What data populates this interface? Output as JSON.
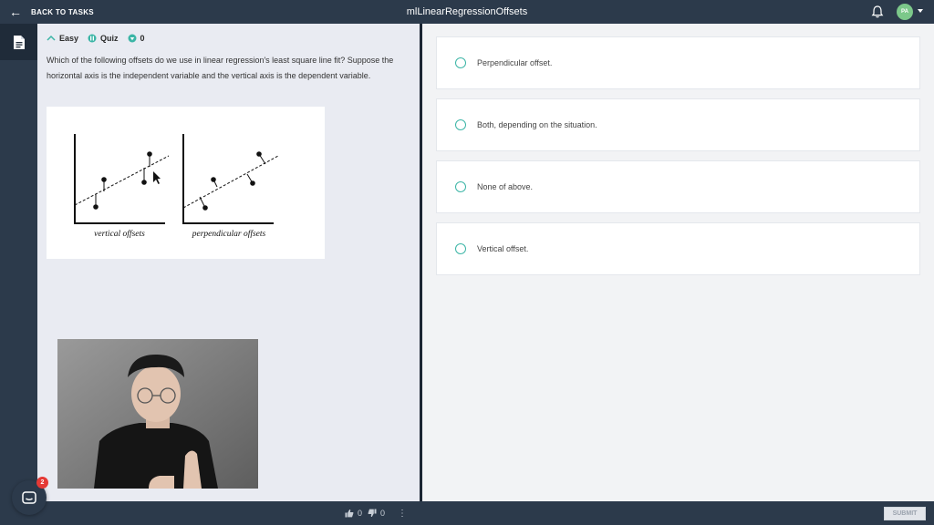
{
  "header": {
    "back_label": "BACK TO TASKS",
    "title": "mlLinearRegressionOffsets",
    "avatar_initials": "PA"
  },
  "task": {
    "difficulty": "Easy",
    "type": "Quiz",
    "score": "0",
    "question": "Which of the following offsets do we use in linear regression's least square line fit? Suppose the horizontal axis is the independent variable and the vertical axis is the dependent variable.",
    "figure": {
      "left_caption": "vertical offsets",
      "right_caption": "perpendicular offsets"
    }
  },
  "options": [
    {
      "label": "Perpendicular offset."
    },
    {
      "label": "Both, depending on the situation."
    },
    {
      "label": "None of above."
    },
    {
      "label": "Vertical offset."
    }
  ],
  "footer": {
    "likes": "0",
    "dislikes": "0",
    "submit_label": "SUBMIT"
  },
  "chat": {
    "badge_count": "2"
  },
  "colors": {
    "header_bg": "#2c3a4b",
    "accent_teal": "#3bb5a6",
    "badge_red": "#e53935"
  }
}
